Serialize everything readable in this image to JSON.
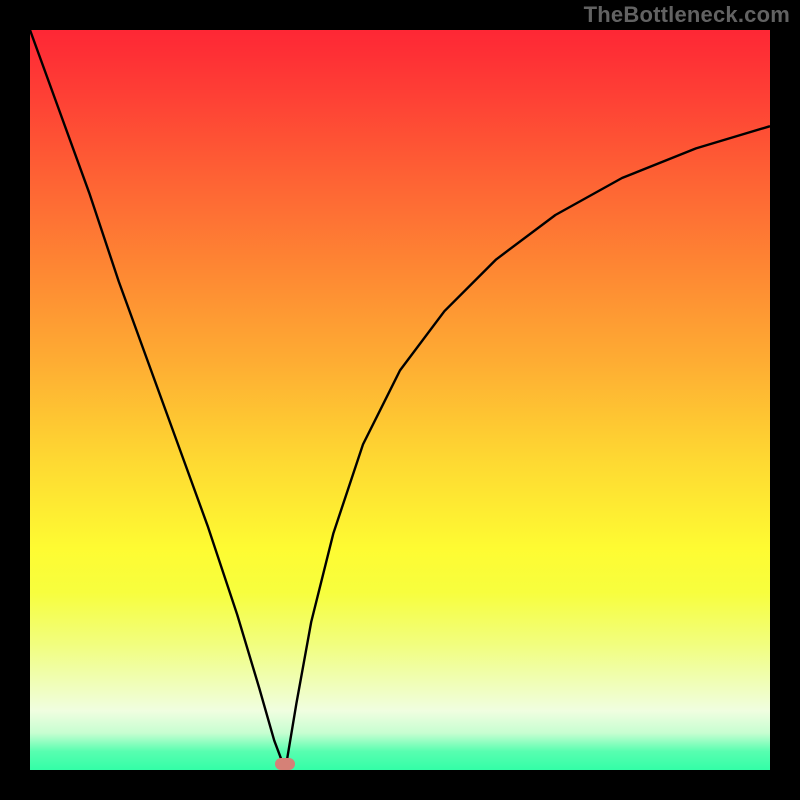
{
  "watermark": "TheBottleneck.com",
  "colors": {
    "curve_stroke": "#000000",
    "marker_fill": "#d58177",
    "frame_bg": "#000000"
  },
  "chart_data": {
    "type": "line",
    "title": "",
    "xlabel": "",
    "ylabel": "",
    "xlim": [
      0,
      100
    ],
    "ylim": [
      0,
      100
    ],
    "min_x_percent": 34.5,
    "left": {
      "x": [
        0,
        4,
        8,
        12,
        16,
        20,
        24,
        28,
        31,
        33,
        34.5
      ],
      "y": [
        100,
        89,
        78,
        66,
        55,
        44,
        33,
        21,
        11,
        4,
        0
      ]
    },
    "right": {
      "x": [
        34.5,
        36,
        38,
        41,
        45,
        50,
        56,
        63,
        71,
        80,
        90,
        100
      ],
      "y": [
        0,
        9,
        20,
        32,
        44,
        54,
        62,
        69,
        75,
        80,
        84,
        87
      ]
    },
    "marker": {
      "x_percent": 34.5,
      "y_percent": 0.8
    }
  }
}
